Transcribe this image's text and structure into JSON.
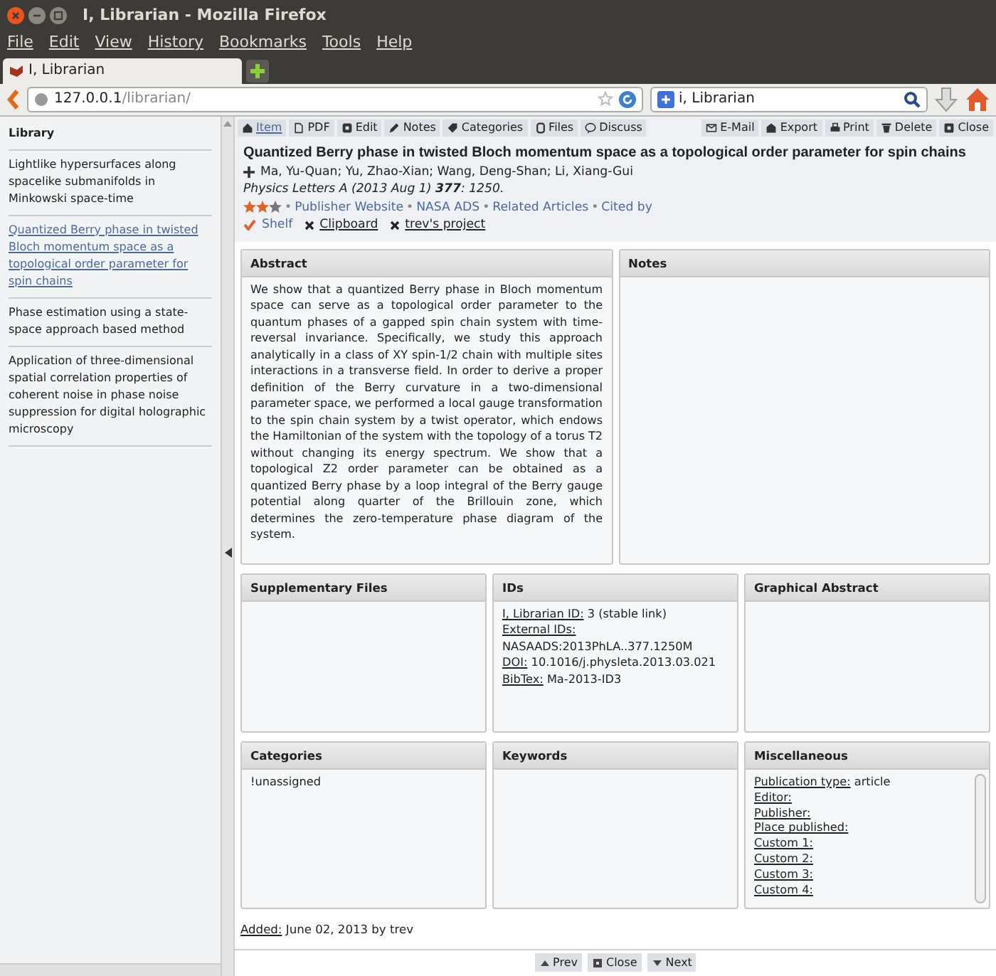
{
  "window": {
    "title": "I, Librarian - Mozilla Firefox"
  },
  "menu": [
    "File",
    "Edit",
    "View",
    "History",
    "Bookmarks",
    "Tools",
    "Help"
  ],
  "browser_tab": {
    "title": "I, Librarian"
  },
  "address_bar": {
    "host": "127.0.0.1",
    "path": "/librarian/"
  },
  "search_bar": {
    "value": "i, Librarian"
  },
  "sidebar": {
    "title": "Library",
    "items": [
      {
        "title": "Lightlike hypersurfaces along spacelike submanifolds in Minkowski space-time",
        "selected": false
      },
      {
        "title": "Quantized Berry phase in twisted Bloch momentum space as a topological order parameter for spin chains",
        "selected": true
      },
      {
        "title": "Phase estimation using a state-space approach based method",
        "selected": false
      },
      {
        "title": "Application of three-dimensional spatial correlation properties of coherent noise in phase noise suppression for digital holographic microscopy",
        "selected": false
      }
    ]
  },
  "toolbar": {
    "left": [
      {
        "label": "Item",
        "selected": true
      },
      {
        "label": "PDF",
        "selected": false
      },
      {
        "label": "Edit",
        "selected": false
      },
      {
        "label": "Notes",
        "selected": false
      },
      {
        "label": "Categories",
        "selected": false
      },
      {
        "label": "Files",
        "selected": false
      },
      {
        "label": "Discuss",
        "selected": false
      }
    ],
    "right": [
      "E-Mail",
      "Export",
      "Print",
      "Delete",
      "Close"
    ]
  },
  "article": {
    "title": "Quantized Berry phase in twisted Bloch momentum space as a topological order parameter for spin chains",
    "authors": "Ma, Yu-Quan; Yu, Zhao-Xian; Wang, Deng-Shan; Li, Xiang-Gui",
    "journal": "Physics Letters A (2013 Aug 1) **377**: 1250.",
    "stars": 2,
    "links": [
      {
        "separator": "•",
        "label": "Publisher Website"
      },
      {
        "separator": "•",
        "label": "NASA ADS"
      },
      {
        "separator": "•",
        "label": "Related Articles"
      },
      {
        "separator": "•",
        "label": "Cited by"
      }
    ],
    "projects": [
      {
        "label": "Shelf",
        "checked": true
      },
      {
        "label": "Clipboard",
        "checked": false
      },
      {
        "label": "trev's project",
        "checked": false
      }
    ]
  },
  "panel_rows": [
    [
      {
        "title": "Abstract",
        "text": "We show that a quantized Berry phase in Bloch momentum space can serve as a topological order parameter to the quantum phases of a gapped spin chain system with time-reversal invariance. Specifically, we study this approach analytically in a class of XY spin-1/2 chain with multiple sites interactions in a transverse field. In order to derive a proper definition of the Berry curvature in a two-dimensional parameter space, we performed a local gauge transformation to the spin chain system by a twist operator, which endows the Hamiltonian of the system with the topology of a torus T2 without changing its energy spectrum. We show that a topological Z2 order parameter can be obtained as a quantized Berry phase by a loop integral of the Berry gauge potential along quarter of the Brillouin zone, which determines the zero-temperature phase diagram of the system."
      },
      {
        "title": "Notes"
      }
    ],
    [
      {
        "title": "Supplementary Files"
      },
      {
        "title": "IDs",
        "fields": [
          {
            "label": "I, Librarian ID:",
            "value": "3 (stable link)"
          },
          {
            "label": "External IDs:"
          },
          {
            "value": "NASAADS:2013PhLA..377.1250M"
          },
          {
            "label": "DOI:",
            "value": "10.1016/j.physleta.2013.03.021"
          },
          {
            "label": "BibTex:",
            "value": "Ma-2013-ID3"
          }
        ]
      },
      {
        "title": "Graphical Abstract"
      }
    ],
    [
      {
        "title": "Categories",
        "fields": [
          {
            "value": "!unassigned"
          }
        ]
      },
      {
        "title": "Keywords"
      },
      {
        "title": "Miscellaneous",
        "scrollable": true,
        "fields": [
          {
            "label": "Publication type:",
            "value": "article"
          },
          {
            "label": "Editor:"
          },
          {
            "label": "Publisher:"
          },
          {
            "label": "Place published:"
          },
          {
            "label": "Custom 1:"
          },
          {
            "label": "Custom 2:"
          },
          {
            "label": "Custom 3:"
          },
          {
            "label": "Custom 4:"
          }
        ]
      }
    ]
  ],
  "added": {
    "label": "Added:",
    "value": "June 02, 2013 by trev"
  },
  "bottom_nav": [
    "Prev",
    "Close",
    "Next"
  ]
}
